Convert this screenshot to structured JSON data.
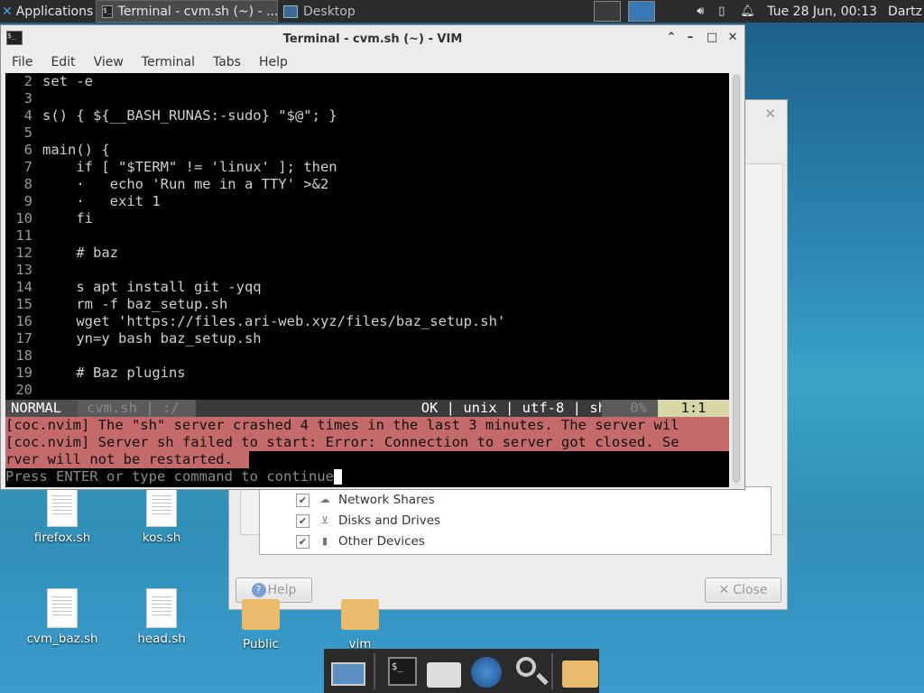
{
  "top_panel": {
    "applications_label": "Applications",
    "task_terminal": "Terminal - cvm.sh (~) - ...",
    "task_desktop": "Desktop",
    "clock": "Tue 28 Jun, 00:13",
    "user": "Dartz"
  },
  "background_dialog": {
    "devices": [
      {
        "label": "Network Shares",
        "checked": true
      },
      {
        "label": "Disks and Drives",
        "checked": true
      },
      {
        "label": "Other Devices",
        "checked": true
      }
    ],
    "help_button": "Help",
    "close_button": "Close"
  },
  "desktop_icons": [
    {
      "label": "firefox.sh"
    },
    {
      "label": "kos.sh"
    },
    {
      "label": "cvm_baz.sh"
    },
    {
      "label": "head.sh"
    },
    {
      "label": "Public"
    },
    {
      "label": "vim"
    }
  ],
  "terminal": {
    "title": "Terminal - cvm.sh (~) - VIM",
    "menu": [
      "File",
      "Edit",
      "View",
      "Terminal",
      "Tabs",
      "Help"
    ],
    "code_lines": [
      {
        "num": "2",
        "text": "set -e"
      },
      {
        "num": "3",
        "text": ""
      },
      {
        "num": "4",
        "text": "s() { ${__BASH_RUNAS:-sudo} \"$@\"; }"
      },
      {
        "num": "5",
        "text": ""
      },
      {
        "num": "6",
        "text": "main() {"
      },
      {
        "num": "7",
        "text": "    if [ \"$TERM\" != 'linux' ]; then"
      },
      {
        "num": "8",
        "text": "    ·   echo 'Run me in a TTY' >&2"
      },
      {
        "num": "9",
        "text": "    ·   exit 1"
      },
      {
        "num": "10",
        "text": "    fi"
      },
      {
        "num": "11",
        "text": ""
      },
      {
        "num": "12",
        "text": "    # baz"
      },
      {
        "num": "13",
        "text": ""
      },
      {
        "num": "14",
        "text": "    s apt install git -yqq"
      },
      {
        "num": "15",
        "text": "    rm -f baz_setup.sh"
      },
      {
        "num": "16",
        "text": "    wget 'https://files.ari-web.xyz/files/baz_setup.sh'"
      },
      {
        "num": "17",
        "text": "    yn=y bash baz_setup.sh"
      },
      {
        "num": "18",
        "text": ""
      },
      {
        "num": "19",
        "text": "    # Baz plugins"
      },
      {
        "num": "20",
        "text": ""
      }
    ],
    "statusline": {
      "mode": "NORMAL",
      "file": "cvm.sh | :/",
      "info": "OK | unix | utf-8 | sh",
      "percent": "0%",
      "position": "1:1"
    },
    "messages": [
      "[coc.nvim] The \"sh\" server crashed 4 times in the last 3 minutes. The server wil",
      "[coc.nvim] Server sh failed to start: Error: Connection to server got closed. Se",
      "rver will not be restarted."
    ],
    "prompt": "Press ENTER or type command to continue"
  },
  "colors": {
    "error_bg": "#c56a6a",
    "position_bg": "#d7d7a6",
    "panel_bg": "#2b2b2b"
  }
}
